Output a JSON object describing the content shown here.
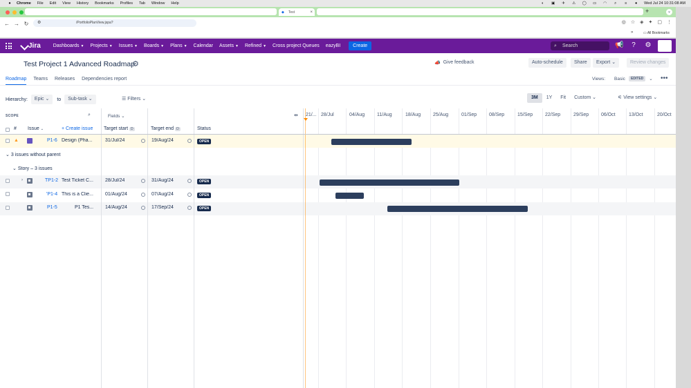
{
  "mac": {
    "apple": "",
    "app": "Chrome",
    "menus": [
      "File",
      "Edit",
      "View",
      "History",
      "Bookmarks",
      "Profiles",
      "Tab",
      "Window",
      "Help"
    ],
    "clock": "Wed Jul 24  10:31:08 AM"
  },
  "browser": {
    "active_tab_title": "Test",
    "url": "/PortfolioPlanView.jspa?",
    "bookmarks_label": "All Bookmarks"
  },
  "nav": {
    "product": "Jira",
    "items": [
      "Dashboards",
      "Projects",
      "Issues",
      "Boards",
      "Plans",
      "Calendar",
      "Assets",
      "Refined",
      "Cross project Queues",
      "eazyBI"
    ],
    "items_with_caret": [
      true,
      true,
      true,
      true,
      true,
      false,
      true,
      true,
      false,
      false
    ],
    "create_label": "Create",
    "search_placeholder": "Search",
    "brand_color": "#6a1b9a"
  },
  "page": {
    "title": "Test Project 1 Advanced Roadmap",
    "feedback": "Give feedback",
    "auto_schedule": "Auto-schedule",
    "share": "Share",
    "export": "Export",
    "review": "Review changes",
    "tabs": [
      "Roadmap",
      "Teams",
      "Releases",
      "Dependencies report"
    ],
    "active_tab": 0,
    "views_label": "Views:",
    "view_name": "Basic",
    "edited": "EDITED",
    "hierarchy_label": "Hierarchy:",
    "hierarchy_from": "Epic",
    "to_label": "to",
    "hierarchy_to": "Sub-task",
    "filters": "Filters",
    "zoom": [
      "3M",
      "1Y",
      "Fit",
      "Custom"
    ],
    "zoom_active": 0,
    "view_settings": "View settings"
  },
  "table": {
    "scope": "SCOPE",
    "fields": "Fields",
    "col_hash": "#",
    "col_issue": "Issue",
    "create_issue": "Create issue",
    "col_target_start": "Target start",
    "col_target_end": "Target end",
    "col_status": "Status",
    "d_badge": "D",
    "group_label": "3 issues without parent",
    "subgroup_label": "Story – 3 issues",
    "rows": [
      {
        "key": "P1-6",
        "summary": "Design (Pha...",
        "start": "31/Jul/24",
        "end": "19/Aug/24",
        "status": "OPEN",
        "type": "epic"
      },
      {
        "key": "TP1-2",
        "summary": "Test Ticket C...",
        "start": "28/Jul/24",
        "end": "31/Aug/24",
        "status": "OPEN",
        "type": "story"
      },
      {
        "key": "'P1-4",
        "summary": "This is a Clie...",
        "start": "01/Aug/24",
        "end": "07/Aug/24",
        "status": "OPEN",
        "type": "story"
      },
      {
        "key": "P1-5",
        "summary": "P1 Tes...",
        "start": "14/Aug/24",
        "end": "17/Sep/24",
        "status": "OPEN",
        "type": "story"
      }
    ]
  },
  "timeline": {
    "labels": [
      "21/...",
      "28/Jul",
      "04/Aug",
      "11/Aug",
      "18/Aug",
      "25/Aug",
      "01/Sep",
      "08/Sep",
      "15/Sep",
      "22/Sep",
      "29/Sep",
      "06/Oct",
      "13/Oct",
      "20/Oct"
    ]
  }
}
